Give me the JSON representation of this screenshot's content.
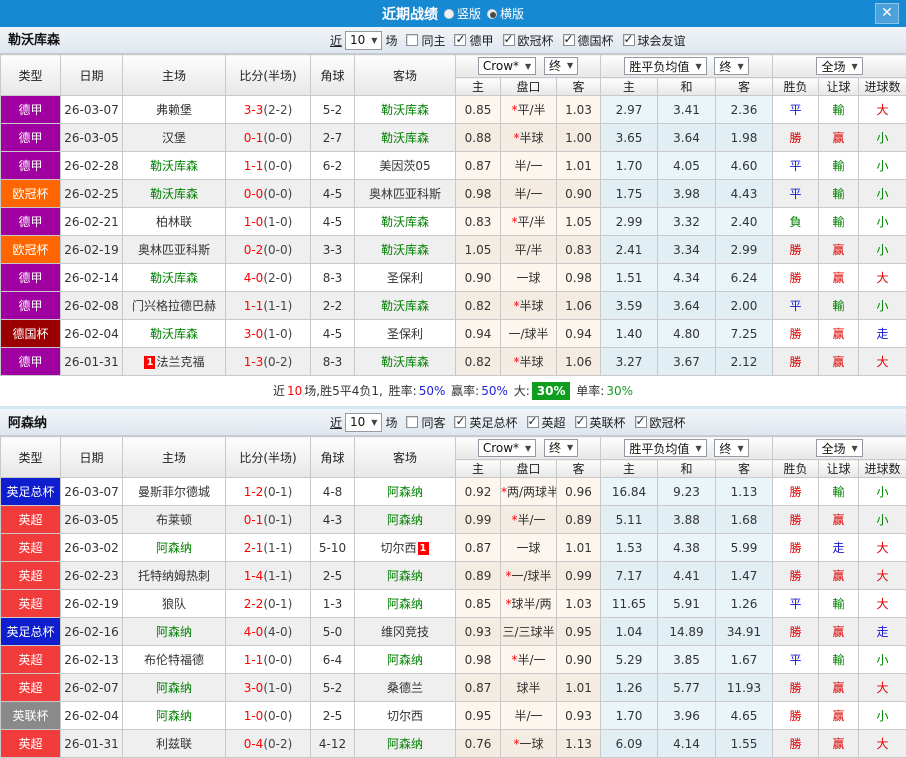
{
  "titlebar": {
    "title": "近期战绩",
    "vertical": "竖版",
    "horizontal": "横版",
    "close": "✕"
  },
  "icons": {
    "dropdown_arrow": "▼",
    "close": "✕"
  },
  "colors": {
    "topbar": "#1789d2",
    "team_highlight": "#008000",
    "score_red": "#ff0000",
    "summary_badge_green": "#0f9d1d"
  },
  "league_colors": {
    "德甲": "#a000a0",
    "欧冠杯": "#ff6600",
    "德国杯": "#9a0000",
    "英足总杯": "#0f1ecc",
    "英超": "#f23b3b",
    "英联杯": "#8a8a8a"
  },
  "result_colors": {
    "勝": "#e00000",
    "平": "#1515d0",
    "負": "#008000",
    "赢": "#e00000",
    "輸": "#008000",
    "走": "#1515d0",
    "大": "#e00000",
    "小": "#008000"
  },
  "table_header": {
    "type": "类型",
    "date": "日期",
    "home": "主场",
    "score": "比分(半场)",
    "corner": "角球",
    "away": "客场",
    "crown": "Crow*",
    "final": "终",
    "avg": "胜平负均值",
    "final2": "终",
    "fulltime": "全场",
    "sub": [
      "主",
      "盘口",
      "客",
      "主",
      "和",
      "客",
      "胜负",
      "让球",
      "进球数"
    ]
  },
  "sections": [
    {
      "team": "勒沃库森",
      "filter": {
        "near": "近",
        "games": "10",
        "games_suffix": "场",
        "same": "同主",
        "leagues": [
          "德甲",
          "欧冠杯",
          "德国杯",
          "球会友谊"
        ]
      },
      "rows": [
        {
          "league": "德甲",
          "date": "26-03-07",
          "home": "弗赖堡",
          "home_hl": false,
          "score": "3-3",
          "half": "(2-2)",
          "corner": "5-2",
          "away": "勒沃库森",
          "away_hl": true,
          "o_home": "0.85",
          "handicap": "*平/半",
          "o_away": "1.03",
          "win": "2.97",
          "draw": "3.41",
          "lose": "2.36",
          "res": "平",
          "hres": "輸",
          "goals": "大"
        },
        {
          "league": "德甲",
          "date": "26-03-05",
          "home": "汉堡",
          "home_hl": false,
          "score": "0-1",
          "half": "(0-0)",
          "corner": "2-7",
          "away": "勒沃库森",
          "away_hl": true,
          "o_home": "0.88",
          "handicap": "*半球",
          "o_away": "1.00",
          "win": "3.65",
          "draw": "3.64",
          "lose": "1.98",
          "res": "勝",
          "hres": "赢",
          "goals": "小"
        },
        {
          "league": "德甲",
          "date": "26-02-28",
          "home": "勒沃库森",
          "home_hl": true,
          "score": "1-1",
          "half": "(0-0)",
          "corner": "6-2",
          "away": "美因茨05",
          "away_hl": false,
          "o_home": "0.87",
          "handicap": "半/一",
          "o_away": "1.01",
          "win": "1.70",
          "draw": "4.05",
          "lose": "4.60",
          "res": "平",
          "hres": "輸",
          "goals": "小"
        },
        {
          "league": "欧冠杯",
          "date": "26-02-25",
          "home": "勒沃库森",
          "home_hl": true,
          "score": "0-0",
          "half": "(0-0)",
          "corner": "4-5",
          "away": "奥林匹亚科斯",
          "away_hl": false,
          "o_home": "0.98",
          "handicap": "半/一",
          "o_away": "0.90",
          "win": "1.75",
          "draw": "3.98",
          "lose": "4.43",
          "res": "平",
          "hres": "輸",
          "goals": "小"
        },
        {
          "league": "德甲",
          "date": "26-02-21",
          "home": "柏林联",
          "home_hl": false,
          "score": "1-0",
          "half": "(1-0)",
          "corner": "4-5",
          "away": "勒沃库森",
          "away_hl": true,
          "o_home": "0.83",
          "handicap": "*平/半",
          "o_away": "1.05",
          "win": "2.99",
          "draw": "3.32",
          "lose": "2.40",
          "res": "負",
          "hres": "輸",
          "goals": "小"
        },
        {
          "league": "欧冠杯",
          "date": "26-02-19",
          "home": "奥林匹亚科斯",
          "home_hl": false,
          "score": "0-2",
          "half": "(0-0)",
          "corner": "3-3",
          "away": "勒沃库森",
          "away_hl": true,
          "o_home": "1.05",
          "handicap": "平/半",
          "o_away": "0.83",
          "win": "2.41",
          "draw": "3.34",
          "lose": "2.99",
          "res": "勝",
          "hres": "赢",
          "goals": "小"
        },
        {
          "league": "德甲",
          "date": "26-02-14",
          "home": "勒沃库森",
          "home_hl": true,
          "score": "4-0",
          "half": "(2-0)",
          "corner": "8-3",
          "away": "圣保利",
          "away_hl": false,
          "o_home": "0.90",
          "handicap": "一球",
          "o_away": "0.98",
          "win": "1.51",
          "draw": "4.34",
          "lose": "6.24",
          "res": "勝",
          "hres": "赢",
          "goals": "大"
        },
        {
          "league": "德甲",
          "date": "26-02-08",
          "home": "门兴格拉德巴赫",
          "home_hl": false,
          "score": "1-1",
          "half": "(1-1)",
          "corner": "2-2",
          "away": "勒沃库森",
          "away_hl": true,
          "o_home": "0.82",
          "handicap": "*半球",
          "o_away": "1.06",
          "win": "3.59",
          "draw": "3.64",
          "lose": "2.00",
          "res": "平",
          "hres": "輸",
          "goals": "小"
        },
        {
          "league": "德国杯",
          "date": "26-02-04",
          "home": "勒沃库森",
          "home_hl": true,
          "score": "3-0",
          "half": "(1-0)",
          "corner": "4-5",
          "away": "圣保利",
          "away_hl": false,
          "o_home": "0.94",
          "handicap": "一/球半",
          "o_away": "0.94",
          "win": "1.40",
          "draw": "4.80",
          "lose": "7.25",
          "res": "勝",
          "hres": "赢",
          "goals": "走"
        },
        {
          "league": "德甲",
          "date": "26-01-31",
          "home": "法兰克福",
          "home_hl": false,
          "home_badge": "1",
          "score": "1-3",
          "half": "(0-2)",
          "corner": "8-3",
          "away": "勒沃库森",
          "away_hl": true,
          "o_home": "0.82",
          "handicap": "*半球",
          "o_away": "1.06",
          "win": "3.27",
          "draw": "3.67",
          "lose": "2.12",
          "res": "勝",
          "hres": "赢",
          "goals": "大"
        }
      ],
      "summary": [
        {
          "text": "近",
          "color": "#333333"
        },
        {
          "text": "10",
          "color": "#ff0000"
        },
        {
          "text": "场,胜5平4负1, ",
          "color": "#333333"
        },
        {
          "text": "胜率:",
          "color": "#333333"
        },
        {
          "text": "50%",
          "color": "#2222dd"
        },
        {
          "text": " 赢率:",
          "color": "#333333"
        },
        {
          "text": "50%",
          "color": "#2222dd"
        },
        {
          "text": " 大:",
          "color": "#333333"
        },
        {
          "text": "30%",
          "color": "#ffffff",
          "bg": "#0f9d1d"
        },
        {
          "text": " 单率:",
          "color": "#333333"
        },
        {
          "text": "30%",
          "color": "#0f9d1d"
        }
      ]
    },
    {
      "team": "阿森纳",
      "filter": {
        "near": "近",
        "games": "10",
        "games_suffix": "场",
        "same": "同客",
        "leagues": [
          "英足总杯",
          "英超",
          "英联杯",
          "欧冠杯"
        ]
      },
      "rows": [
        {
          "league": "英足总杯",
          "date": "26-03-07",
          "home": "曼斯菲尔德城",
          "home_hl": false,
          "score": "1-2",
          "half": "(0-1)",
          "corner": "4-8",
          "away": "阿森纳",
          "away_hl": true,
          "o_home": "0.92",
          "handicap": "*两/两球半",
          "o_away": "0.96",
          "win": "16.84",
          "draw": "9.23",
          "lose": "1.13",
          "res": "勝",
          "hres": "輸",
          "goals": "小"
        },
        {
          "league": "英超",
          "date": "26-03-05",
          "home": "布莱顿",
          "home_hl": false,
          "score": "0-1",
          "half": "(0-1)",
          "corner": "4-3",
          "away": "阿森纳",
          "away_hl": true,
          "o_home": "0.99",
          "handicap": "*半/一",
          "o_away": "0.89",
          "win": "5.11",
          "draw": "3.88",
          "lose": "1.68",
          "res": "勝",
          "hres": "赢",
          "goals": "小"
        },
        {
          "league": "英超",
          "date": "26-03-02",
          "home": "阿森纳",
          "home_hl": true,
          "score": "2-1",
          "half": "(1-1)",
          "corner": "5-10",
          "away": "切尔西",
          "away_hl": false,
          "away_badge": "1",
          "away_badge_after": true,
          "o_home": "0.87",
          "handicap": "一球",
          "o_away": "1.01",
          "win": "1.53",
          "draw": "4.38",
          "lose": "5.99",
          "res": "勝",
          "hres": "走",
          "goals": "大"
        },
        {
          "league": "英超",
          "date": "26-02-23",
          "home": "托特纳姆热刺",
          "home_hl": false,
          "score": "1-4",
          "half": "(1-1)",
          "corner": "2-5",
          "away": "阿森纳",
          "away_hl": true,
          "o_home": "0.89",
          "handicap": "*一/球半",
          "o_away": "0.99",
          "win": "7.17",
          "draw": "4.41",
          "lose": "1.47",
          "res": "勝",
          "hres": "赢",
          "goals": "大"
        },
        {
          "league": "英超",
          "date": "26-02-19",
          "home": "狼队",
          "home_hl": false,
          "score": "2-2",
          "half": "(0-1)",
          "corner": "1-3",
          "away": "阿森纳",
          "away_hl": true,
          "o_home": "0.85",
          "handicap": "*球半/两",
          "o_away": "1.03",
          "win": "11.65",
          "draw": "5.91",
          "lose": "1.26",
          "res": "平",
          "hres": "輸",
          "goals": "大"
        },
        {
          "league": "英足总杯",
          "date": "26-02-16",
          "home": "阿森纳",
          "home_hl": true,
          "score": "4-0",
          "half": "(4-0)",
          "corner": "5-0",
          "away": "维冈竞技",
          "away_hl": false,
          "o_home": "0.93",
          "handicap": "三/三球半",
          "o_away": "0.95",
          "win": "1.04",
          "draw": "14.89",
          "lose": "34.91",
          "res": "勝",
          "hres": "赢",
          "goals": "走"
        },
        {
          "league": "英超",
          "date": "26-02-13",
          "home": "布伦特福德",
          "home_hl": false,
          "score": "1-1",
          "half": "(0-0)",
          "corner": "6-4",
          "away": "阿森纳",
          "away_hl": true,
          "o_home": "0.98",
          "handicap": "*半/一",
          "o_away": "0.90",
          "win": "5.29",
          "draw": "3.85",
          "lose": "1.67",
          "res": "平",
          "hres": "輸",
          "goals": "小"
        },
        {
          "league": "英超",
          "date": "26-02-07",
          "home": "阿森纳",
          "home_hl": true,
          "score": "3-0",
          "half": "(1-0)",
          "corner": "5-2",
          "away": "桑德兰",
          "away_hl": false,
          "o_home": "0.87",
          "handicap": "球半",
          "o_away": "1.01",
          "win": "1.26",
          "draw": "5.77",
          "lose": "11.93",
          "res": "勝",
          "hres": "赢",
          "goals": "大"
        },
        {
          "league": "英联杯",
          "date": "26-02-04",
          "home": "阿森纳",
          "home_hl": true,
          "score": "1-0",
          "half": "(0-0)",
          "corner": "2-5",
          "away": "切尔西",
          "away_hl": false,
          "o_home": "0.95",
          "handicap": "半/一",
          "o_away": "0.93",
          "win": "1.70",
          "draw": "3.96",
          "lose": "4.65",
          "res": "勝",
          "hres": "赢",
          "goals": "小"
        },
        {
          "league": "英超",
          "date": "26-01-31",
          "home": "利兹联",
          "home_hl": false,
          "score": "0-4",
          "half": "(0-2)",
          "corner": "4-12",
          "away": "阿森纳",
          "away_hl": true,
          "o_home": "0.76",
          "handicap": "*一球",
          "o_away": "1.13",
          "win": "6.09",
          "draw": "4.14",
          "lose": "1.55",
          "res": "勝",
          "hres": "赢",
          "goals": "大"
        }
      ]
    }
  ]
}
